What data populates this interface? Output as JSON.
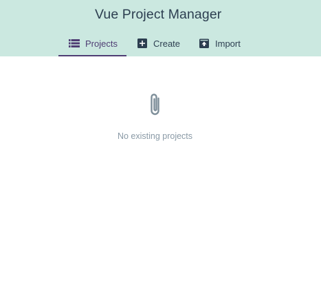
{
  "header": {
    "title": "Vue Project Manager",
    "background": "#cbe8e0"
  },
  "tabs": [
    {
      "label": "Projects",
      "icon": "list-icon",
      "active": true
    },
    {
      "label": "Create",
      "icon": "add-box-icon",
      "active": false
    },
    {
      "label": "Import",
      "icon": "unarchive-icon",
      "active": false
    }
  ],
  "empty_state": {
    "icon": "paperclip-icon",
    "message": "No existing projects"
  },
  "colors": {
    "accent": "#4e3d73",
    "text": "#2c3e50",
    "muted": "#8a9aa6"
  }
}
